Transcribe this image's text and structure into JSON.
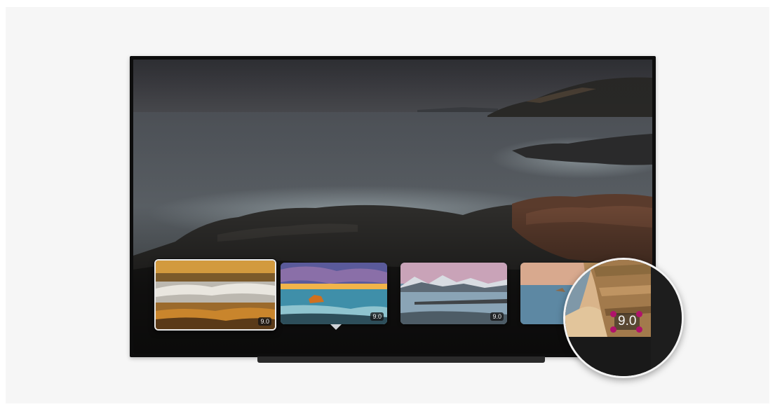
{
  "screen": {
    "background_name": "coastal-long-exposure-photo"
  },
  "carousel": {
    "items": [
      {
        "name": "autumn-river-thumbnail",
        "rating": "9.0",
        "focused": true
      },
      {
        "name": "sunset-sea-rock-thumbnail",
        "rating": "9.0",
        "focused": false
      },
      {
        "name": "mountain-lake-thumbnail",
        "rating": "9.0",
        "focused": false
      },
      {
        "name": "beach-cliff-thumbnail",
        "rating": "",
        "focused": false
      }
    ]
  },
  "magnifier": {
    "rating": "9.0",
    "handle_color": "#b0126b"
  },
  "colors": {
    "page_background": "#f6f6f6",
    "tv_frame": "#0d0d0d",
    "focus_border": "#e9e9e9",
    "rating_badge_bg": "#141414"
  }
}
